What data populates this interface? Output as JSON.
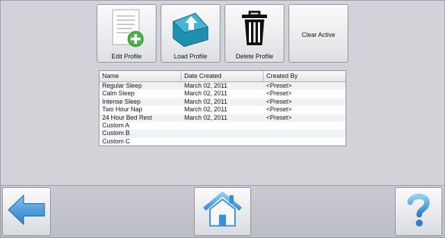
{
  "toolbar": {
    "edit_label": "Edit Profile",
    "load_label": "Load Profile",
    "delete_label": "Delete Profile",
    "clear_label": "Clear Active"
  },
  "table": {
    "columns": [
      "Name",
      "Date Created",
      "Created By"
    ],
    "rows": [
      [
        "Regular Sleep",
        "March 02, 2011",
        "<Preset>"
      ],
      [
        "Calm Sleep",
        "March 02, 2011",
        "<Preset>"
      ],
      [
        "Intense Sleep",
        "March 02, 2011",
        "<Preset>"
      ],
      [
        "Two Hour Nap",
        "March 02, 2011",
        "<Preset>"
      ],
      [
        "24 Hour Bed Rest",
        "March 02, 2011",
        "<Preset>"
      ],
      [
        "Custom A",
        "",
        ""
      ],
      [
        "Custom B",
        "",
        ""
      ],
      [
        "Custom C",
        "",
        ""
      ]
    ]
  },
  "nav": {
    "back_icon": "back-arrow-icon",
    "home_icon": "home-icon",
    "help_icon": "help-icon"
  },
  "colors": {
    "background": "#d2d3d9",
    "accent_blue": "#3a8fd6",
    "folder_teal": "#1f8fb0",
    "add_green": "#4bb34b"
  }
}
